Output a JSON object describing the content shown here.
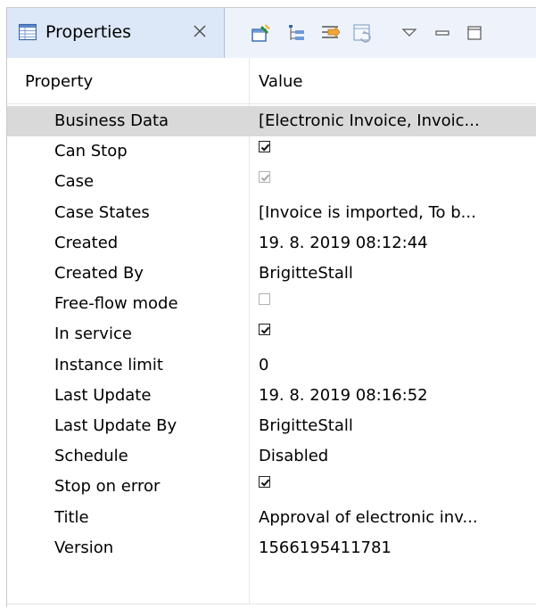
{
  "view": {
    "tab_label": "Properties",
    "tab_icon": "properties-table-icon",
    "close_icon": "close-tab-icon",
    "toolbar_icons": [
      "pin-to-selection-icon",
      "show-categories-icon",
      "show-advanced-properties-icon",
      "restore-default-value-icon",
      "view-menu-chevron-icon",
      "minimize-icon",
      "maximize-icon"
    ]
  },
  "table": {
    "headers": {
      "property": "Property",
      "value": "Value"
    },
    "rows": [
      {
        "name": "Business Data",
        "value": "[Electronic Invoice, Invoic...",
        "selected": true
      },
      {
        "name": "Can Stop",
        "checkbox": true,
        "checked": true,
        "disabled": false
      },
      {
        "name": "Case",
        "checkbox": true,
        "checked": true,
        "disabled": true
      },
      {
        "name": "Case States",
        "value": "[Invoice is imported, To b..."
      },
      {
        "name": "Created",
        "value": "19. 8. 2019 08:12:44"
      },
      {
        "name": "Created By",
        "value": "BrigitteStall"
      },
      {
        "name": "Free-flow mode",
        "checkbox": true,
        "checked": false,
        "disabled": true
      },
      {
        "name": "In service",
        "checkbox": true,
        "checked": true,
        "disabled": false
      },
      {
        "name": "Instance limit",
        "value": "0"
      },
      {
        "name": "Last Update",
        "value": "19. 8. 2019 08:16:52"
      },
      {
        "name": "Last Update By",
        "value": "BrigitteStall"
      },
      {
        "name": "Schedule",
        "value": "Disabled"
      },
      {
        "name": "Stop on error",
        "checkbox": true,
        "checked": true,
        "disabled": false
      },
      {
        "name": "Title",
        "value": "Approval of electronic inv..."
      },
      {
        "name": "Version",
        "value": "1566195411781"
      }
    ]
  },
  "colors": {
    "tab_background": "#dce8f8",
    "titlebar_background": "#eef3fb",
    "selected_row": "#d9d9d9",
    "grid_line": "#e6e6e6"
  }
}
